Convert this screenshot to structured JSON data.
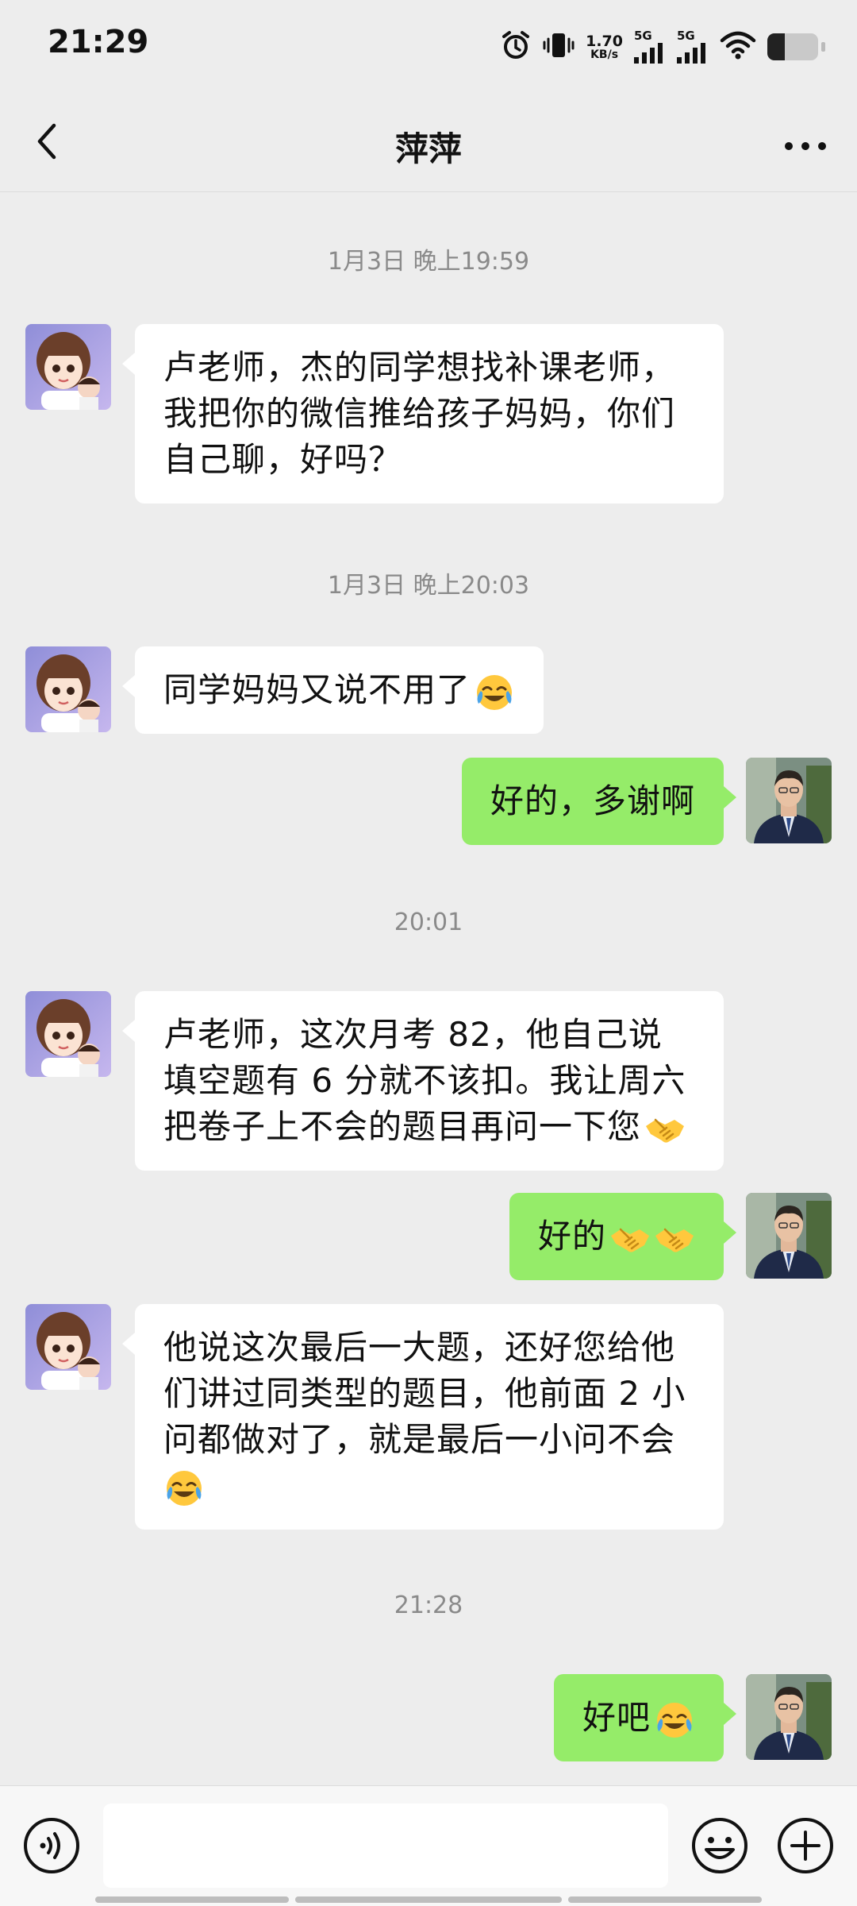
{
  "status_bar": {
    "time": "21:29",
    "net_speed_value": "1.70",
    "net_speed_unit": "KB/s",
    "sim1_label": "5G",
    "sim2_label": "5G",
    "battery_level": 0.35,
    "icons": [
      "alarm-icon",
      "vibrate-icon",
      "signal-icon",
      "wifi-icon",
      "battery-icon"
    ]
  },
  "header": {
    "title": "萍萍",
    "back_icon": "chevron-left-icon",
    "more_icon": "more-dots-icon"
  },
  "messages": [
    {
      "type": "time",
      "text": "1月3日 晚上19:59"
    },
    {
      "type": "in",
      "text": "卢老师，杰的同学想找补课老师，\n我把你的微信推给孩子妈妈，你们\n自己聊，好吗？"
    },
    {
      "type": "time",
      "text": "1月3日 晚上20:03"
    },
    {
      "type": "in",
      "text": "同学妈妈又说不用了",
      "emoji": [
        "tears-of-joy-emoji"
      ]
    },
    {
      "type": "out",
      "text": "好的，多谢啊"
    },
    {
      "type": "time",
      "text": "20:01"
    },
    {
      "type": "in",
      "text": "卢老师，这次月考 82，他自己说\n填空题有 6 分就不该扣。我让周六\n把卷子上不会的题目再问一下您",
      "emoji": [
        "handshake-emoji"
      ]
    },
    {
      "type": "out",
      "text": "好的",
      "emoji": [
        "handshake-emoji",
        "handshake-emoji"
      ]
    },
    {
      "type": "in",
      "text": "他说这次最后一大题，还好您给他\n们讲过同类型的题目，他前面 2 小\n问都做对了，就是最后一小问不会\n",
      "emoji": [
        "tears-of-joy-emoji"
      ]
    },
    {
      "type": "time",
      "text": "21:28"
    },
    {
      "type": "out",
      "text": "好吧",
      "emoji": [
        "tears-of-joy-emoji"
      ]
    }
  ],
  "input_bar": {
    "voice_icon": "voice-icon",
    "input_value": "",
    "emoji_icon": "smiley-icon",
    "plus_icon": "plus-icon"
  },
  "colors": {
    "background": "#ededed",
    "outgoing_bubble": "#95ec69",
    "incoming_bubble": "#ffffff",
    "timestamp_text": "#8a8a8a"
  }
}
